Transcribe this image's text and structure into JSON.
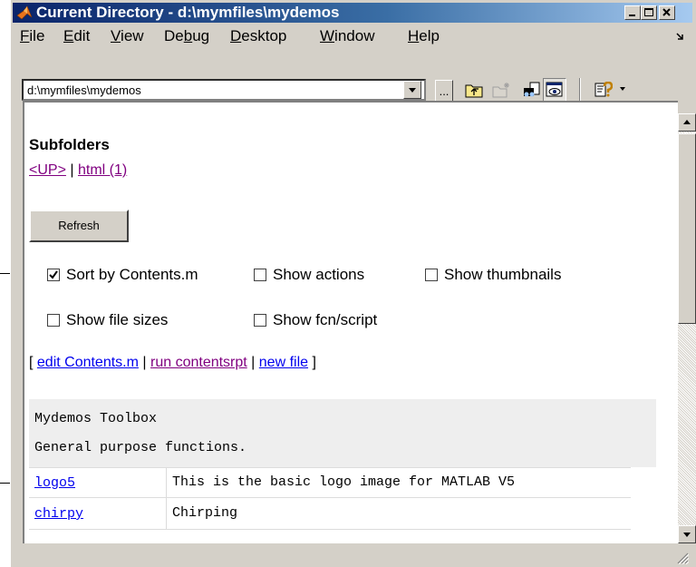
{
  "window": {
    "title": "Current Directory - d:\\mymfiles\\mydemos"
  },
  "menu": {
    "items": [
      {
        "pre": "",
        "u": "F",
        "post": "ile"
      },
      {
        "pre": "",
        "u": "E",
        "post": "dit"
      },
      {
        "pre": "",
        "u": "V",
        "post": "iew"
      },
      {
        "pre": "De",
        "u": "b",
        "post": "ug"
      },
      {
        "pre": "",
        "u": "D",
        "post": "esktop"
      },
      {
        "pre": "",
        "u": "W",
        "post": "indow"
      },
      {
        "pre": "",
        "u": "H",
        "post": "elp"
      }
    ]
  },
  "toolbar": {
    "path_value": "d:\\mymfiles\\mydemos",
    "browse_label": "...",
    "icons": [
      "up-folder-icon",
      "new-folder-icon",
      "find-files-icon",
      "show-html-icon",
      "help-icon"
    ]
  },
  "content": {
    "subfolders_heading": "Subfolders",
    "up_link": "<UP>",
    "separator": " | ",
    "html_link": "html (1)",
    "refresh_label": "Refresh",
    "checkboxes": {
      "sort_by_contents": {
        "label": "Sort by Contents.m",
        "checked": true
      },
      "show_actions": {
        "label": "Show actions",
        "checked": false
      },
      "show_thumbnails": {
        "label": "Show thumbnails",
        "checked": false
      },
      "show_file_sizes": {
        "label": "Show file sizes",
        "checked": false
      },
      "show_fcn_script": {
        "label": "Show fcn/script",
        "checked": false
      }
    },
    "actions": {
      "open_bracket": "[ ",
      "edit_contents": "edit Contents.m",
      "sep1": " | ",
      "run_contentsrpt": "run contentsrpt",
      "sep2": " | ",
      "new_file": "new file",
      "close_bracket": " ]"
    },
    "toolbox": {
      "name": "Mydemos Toolbox",
      "description": "General purpose functions."
    },
    "files": [
      {
        "name": "logo5",
        "description": "This is the basic logo image for MATLAB V5"
      },
      {
        "name": "chirpy",
        "description": "Chirping"
      }
    ]
  }
}
